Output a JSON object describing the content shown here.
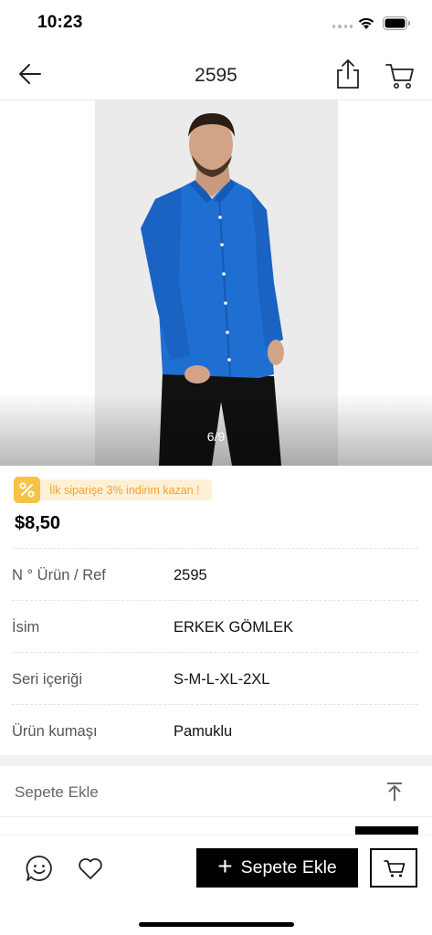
{
  "status_bar": {
    "time": "10:23"
  },
  "nav": {
    "title": "2595"
  },
  "gallery": {
    "counter": "6/9",
    "shirt_color": "#1f6fd3"
  },
  "promo": {
    "text": "İlk siparişe 3% indirim kazan !",
    "accent": "#f6c247"
  },
  "product": {
    "price": "$8,50"
  },
  "details": [
    {
      "label": "N ° Ürün / Ref",
      "value": "2595"
    },
    {
      "label": "İsim",
      "value": "ERKEK GÖMLEK"
    },
    {
      "label": "Seri içeriği",
      "value": "S-M-L-XL-2XL"
    },
    {
      "label": "Ürün kumaşı",
      "value": "Pamuklu"
    }
  ],
  "add_section": {
    "label": "Sepete Ekle"
  },
  "bottom_bar": {
    "add_button_label": "Sepete Ekle"
  },
  "icons": {
    "back": "arrow-left-icon",
    "share": "share-icon",
    "cart": "cart-icon",
    "promo": "percent-icon",
    "to_top": "arrow-up-to-line-icon",
    "chat": "chat-smile-icon",
    "heart": "heart-icon"
  }
}
